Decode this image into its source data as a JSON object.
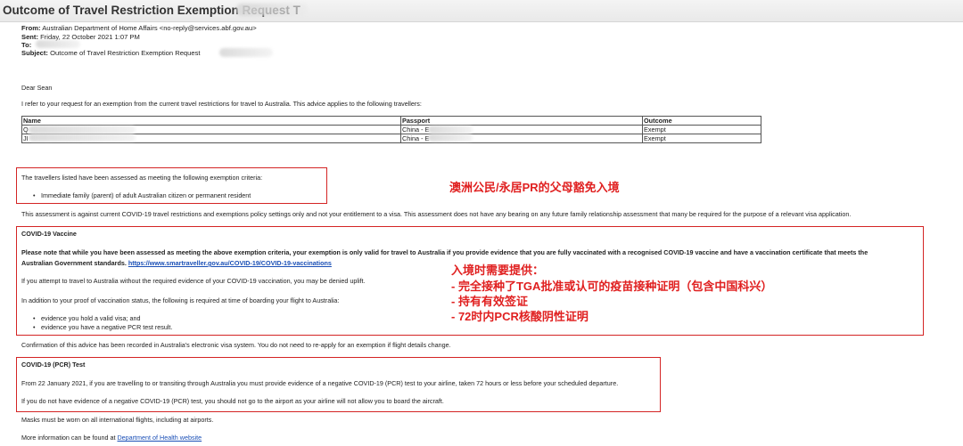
{
  "window": {
    "title": "Outcome of Travel Restriction Exemption Request T"
  },
  "email": {
    "from_label": "From:",
    "from_value": "Australian Department of Home Affairs <no-reply@services.abf.gov.au>",
    "sent_label": "Sent:",
    "sent_value": "Friday, 22 October 2021 1:07 PM",
    "to_label": "To:",
    "subject_label": "Subject:",
    "subject_value": "Outcome of Travel Restriction Exemption Request"
  },
  "body": {
    "greeting": "Dear Sean",
    "intro": "I refer to your request for an exemption from the current travel restrictions for travel to Australia. This advice applies to the following travellers:",
    "table": {
      "headers": [
        "Name",
        "Passport",
        "Outcome"
      ],
      "rows": [
        [
          "Q",
          "China - E",
          "Exempt"
        ],
        [
          "JI",
          "China - E",
          "Exempt"
        ]
      ]
    },
    "criteria_intro": "The travellers listed have been assessed as meeting the following exemption criteria:",
    "criteria_item": "Immediate family (parent) of adult Australian citizen or permanent resident",
    "assessment_note": "This assessment is against current COVID-19 travel restrictions and exemptions policy settings only and not your entitlement to a visa. This assessment does not have any bearing on any future family relationship assessment that many be required for the purpose of a relevant visa application.",
    "vaccine_heading": "COVID-19 Vaccine",
    "vaccine_line1": "Please note that while you have been assessed as meeting the above exemption criteria, your exemption is only valid for travel to Australia if you provide evidence that you are fully vaccinated with a recognised COVID-19 vaccine and have a vaccination certificate that meets the",
    "vaccine_line2": "Australian Government standards.",
    "vaccine_link": "https://www.smartraveller.gov.au/COVID-19/COVID-19-vaccinations",
    "uplift_note": "If you attempt to travel to Australia without the required evidence of your COVID-19 vaccination, you may be denied uplift.",
    "boarding_intro": "In addition to your proof of vaccination status, the following is required at time of boarding your flight to Australia:",
    "boarding_items": [
      "evidence you hold a valid visa; and",
      "evidence you have a negative PCR test result."
    ],
    "confirmation": "Confirmation of this advice has been recorded in Australia's electronic visa system. You do not need to re-apply for an exemption if flight details change.",
    "pcr_heading": "COVID-19 (PCR) Test",
    "pcr_line1": "From 22 January 2021, if you are travelling to or transiting through Australia you must provide evidence of a negative COVID-19 (PCR) test to your airline, taken 72 hours or less before your scheduled departure.",
    "pcr_line2": "If you do not have evidence of a negative COVID-19 (PCR) test, you should not go to the airport as your airline will not allow you to board the aircraft.",
    "masks": "Masks must be worn on all international flights, including at airports.",
    "more_info": "More information can be found at",
    "more_info_link": "Department of Health website"
  },
  "annotations": {
    "exemption": "澳洲公民/永居PR的父母豁免入境",
    "entry_title": "入境时需要提供：",
    "entry_items": [
      "- 完全接种了TGA批准或认可的疫苗接种证明（包含中国科兴）",
      "- 持有有效签证",
      "- 72时内PCR核酸阴性证明"
    ]
  },
  "colors": {
    "annotation_red": "#e02020",
    "box_red": "#d42424",
    "link_blue": "#1a4fb6"
  }
}
